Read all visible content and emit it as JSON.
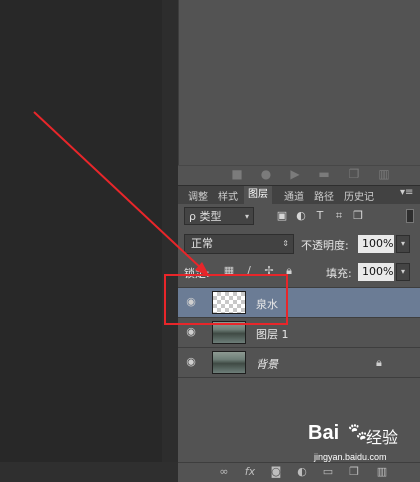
{
  "panel_controls": {
    "icons": [
      "stop-icon",
      "record-icon",
      "play-icon",
      "folder-icon",
      "new-icon",
      "trash-icon"
    ]
  },
  "tabs": [
    {
      "label": "调整",
      "active": false
    },
    {
      "label": "样式",
      "active": false
    },
    {
      "label": "图层",
      "active": true
    },
    {
      "label": "通道",
      "active": false
    },
    {
      "label": "路径",
      "active": false
    },
    {
      "label": "历史记",
      "active": false
    }
  ],
  "filter": {
    "label": "ρ 类型",
    "icons": [
      "image-filter-icon",
      "adjustment-filter-icon",
      "type-filter-icon",
      "shape-filter-icon",
      "smart-object-filter-icon"
    ]
  },
  "blend": {
    "mode": "正常",
    "opacity_label": "不透明度:",
    "opacity_value": "100%"
  },
  "lock": {
    "label": "锁定:",
    "fill_label": "填充:",
    "fill_value": "100%"
  },
  "layers": [
    {
      "name": "泉水",
      "selected": true,
      "thumb": "transparent",
      "locked": false
    },
    {
      "name": "图层 1",
      "selected": false,
      "thumb": "photo",
      "locked": false
    },
    {
      "name": "背景",
      "selected": false,
      "thumb": "photo",
      "locked": true
    }
  ],
  "bottom_toolbar": {
    "icons": [
      "link-icon",
      "fx-icon",
      "mask-icon",
      "adjustment-icon",
      "group-icon",
      "new-layer-icon",
      "delete-icon"
    ]
  },
  "watermark": {
    "brand": "Bai",
    "brand_suffix": "经验",
    "url": "jingyan.baidu.com"
  },
  "colors": {
    "annotation_red": "#e8262a",
    "selected_layer": "#6b7c95",
    "panel_bg": "#535353",
    "canvas_bg": "#282828"
  }
}
